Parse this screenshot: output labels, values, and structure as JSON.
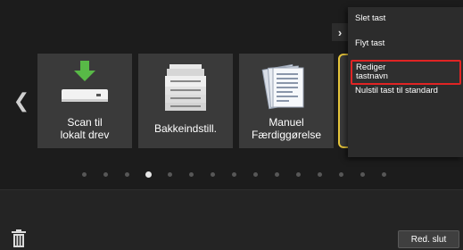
{
  "tiles": [
    {
      "label": "Scan til\nlokalt drev",
      "icon": "usb-drive-download-icon"
    },
    {
      "label": "Bakkeindstill.",
      "icon": "printer-tray-icon"
    },
    {
      "label": "Manuel\nFærdiggørelse",
      "icon": "manual-finishing-documents-icon"
    }
  ],
  "menu": {
    "items": [
      {
        "label": "Slet tast"
      },
      {
        "label": "Flyt tast"
      },
      {
        "label_line1": "Rediger",
        "label_line2": "tastnavn"
      },
      {
        "label": "Nulstil tast til standard"
      }
    ]
  },
  "pager": {
    "total": 16,
    "active_index": 3
  },
  "footer": {
    "finish_button_label": "Red. slut"
  },
  "colors": {
    "selection_outline": "#e6c53c",
    "highlight_border": "#e02424",
    "download_arrow": "#58b947"
  }
}
